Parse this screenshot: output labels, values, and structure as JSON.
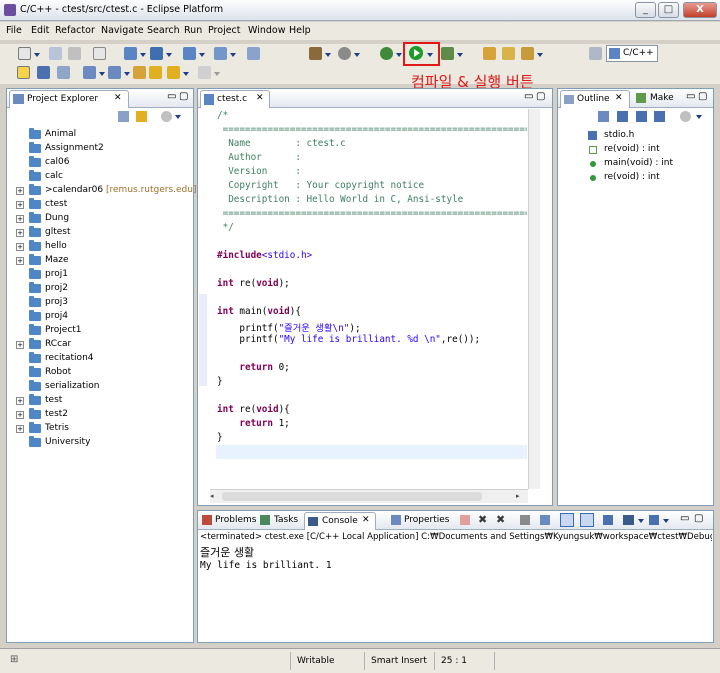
{
  "window": {
    "title": "C/C++ - ctest/src/ctest.c - Eclipse Platform",
    "minimize": "_",
    "maximize": "□",
    "close": "X"
  },
  "menu": [
    "File",
    "Edit",
    "Refactor",
    "Navigate",
    "Search",
    "Run",
    "Project",
    "Window",
    "Help"
  ],
  "annotation": "컴파일 & 실행 버튼",
  "perspective": "C/C++",
  "project_explorer": {
    "title": "Project Explorer",
    "items": [
      {
        "label": "Animal",
        "expand": false
      },
      {
        "label": "Assignment2",
        "expand": false
      },
      {
        "label": "cal06",
        "expand": false
      },
      {
        "label": "calc",
        "expand": false
      },
      {
        "label": ">calendar06",
        "extra": "[remus.rutgers.edu]",
        "expand": true
      },
      {
        "label": "ctest",
        "expand": true
      },
      {
        "label": "Dung",
        "expand": true
      },
      {
        "label": "gltest",
        "expand": true
      },
      {
        "label": "hello",
        "expand": true
      },
      {
        "label": "Maze",
        "expand": true
      },
      {
        "label": "proj1",
        "expand": false
      },
      {
        "label": "proj2",
        "expand": false
      },
      {
        "label": "proj3",
        "expand": false
      },
      {
        "label": "proj4",
        "expand": false
      },
      {
        "label": "Project1",
        "expand": false
      },
      {
        "label": "RCcar",
        "expand": true
      },
      {
        "label": "recitation4",
        "expand": false
      },
      {
        "label": "Robot",
        "expand": false
      },
      {
        "label": "serialization",
        "expand": false
      },
      {
        "label": "test",
        "expand": true
      },
      {
        "label": "test2",
        "expand": true
      },
      {
        "label": "Tetris",
        "expand": true
      },
      {
        "label": "University",
        "expand": false
      }
    ]
  },
  "editor": {
    "tab": "ctest.c",
    "lines": [
      "/*",
      " ============================================================================",
      "  Name        : ctest.c",
      "  Author      :",
      "  Version     :",
      "  Copyright   : Your copyright notice",
      "  Description : Hello World in C, Ansi-style",
      " ============================================================================",
      " */",
      "",
      "#include<stdio.h>",
      "",
      "int re(void);",
      "",
      "int main(void){",
      "    printf(\"즐거운 생활\\n\");",
      "    printf(\"My life is brilliant. %d \\n\",re());",
      "",
      "    return 0;",
      "}",
      "",
      "int re(void){",
      "    return 1;",
      "}"
    ]
  },
  "outline": {
    "tabs": [
      "Outline",
      "Make"
    ],
    "items": [
      "stdio.h",
      "re(void) : int",
      "main(void) : int",
      "re(void) : int"
    ]
  },
  "console": {
    "tabs": [
      "Problems",
      "Tasks",
      "Console",
      "Properties"
    ],
    "header": "<terminated> ctest.exe [C/C++ Local Application] C:₩Documents and Settings₩Kyungsuk₩workspace₩ctest₩Debug₩ctest",
    "output": [
      "즐거운 생활",
      "My life is brilliant. 1"
    ]
  },
  "status": {
    "mode": "Writable",
    "insert": "Smart Insert",
    "position": "25 : 1"
  },
  "colors": {
    "accent": "#e01818",
    "run": "#1c9a2a"
  }
}
